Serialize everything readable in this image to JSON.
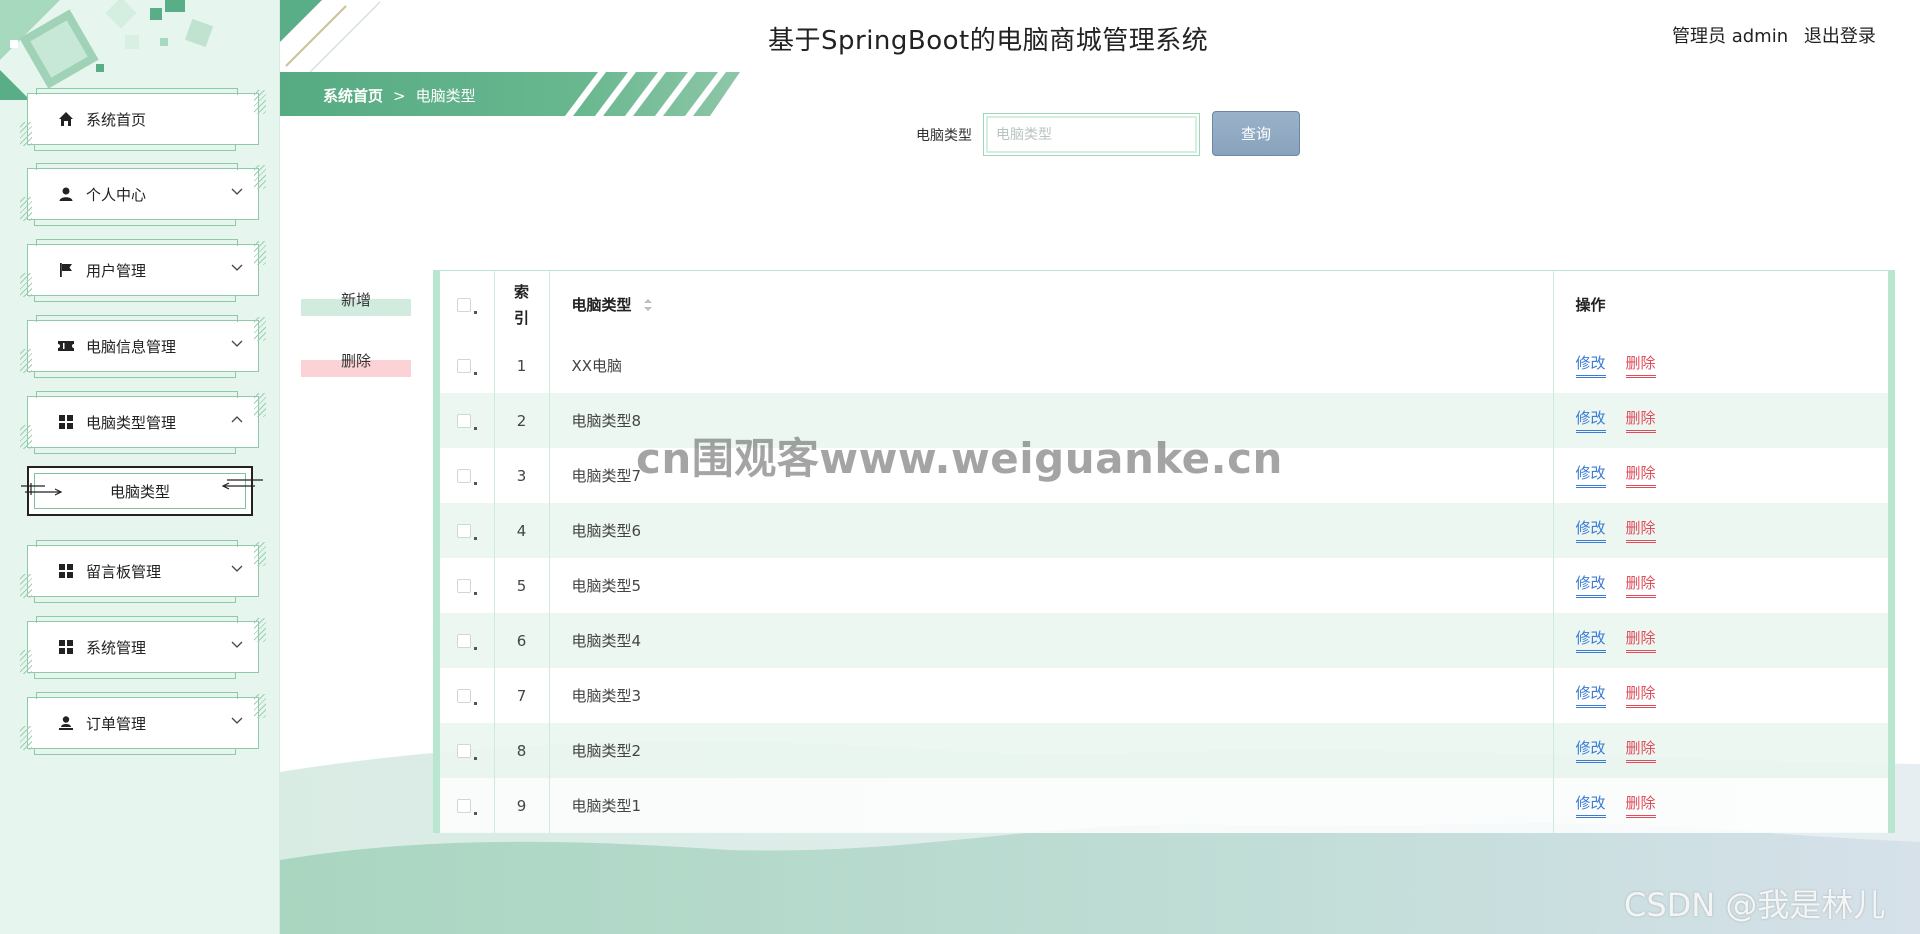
{
  "header": {
    "title": "基于SpringBoot的电脑商城管理系统",
    "user": "管理员 admin",
    "logout": "退出登录"
  },
  "breadcrumb": {
    "home": "系统首页",
    "separator": ">",
    "current": "电脑类型"
  },
  "sidebar": {
    "items": [
      {
        "label": "系统首页",
        "icon": "home-icon"
      },
      {
        "label": "个人中心",
        "icon": "user-icon"
      },
      {
        "label": "用户管理",
        "icon": "flag-icon"
      },
      {
        "label": "电脑信息管理",
        "icon": "ticket-icon"
      },
      {
        "label": "电脑类型管理",
        "icon": "grid-icon"
      },
      {
        "label": "留言板管理",
        "icon": "grid-icon"
      },
      {
        "label": "系统管理",
        "icon": "grid-icon"
      },
      {
        "label": "订单管理",
        "icon": "person-icon"
      }
    ],
    "subitem": "电脑类型"
  },
  "search": {
    "label": "电脑类型",
    "placeholder": "电脑类型",
    "button": "查询"
  },
  "actions": {
    "add": "新增",
    "delete": "删除"
  },
  "table": {
    "headers": {
      "index": "索引",
      "type": "电脑类型",
      "ops": "操作"
    },
    "edit_label": "修改",
    "delete_label": "删除",
    "rows": [
      {
        "index": "1",
        "type": "XX电脑"
      },
      {
        "index": "2",
        "type": "电脑类型8"
      },
      {
        "index": "3",
        "type": "电脑类型7"
      },
      {
        "index": "4",
        "type": "电脑类型6"
      },
      {
        "index": "5",
        "type": "电脑类型5"
      },
      {
        "index": "6",
        "type": "电脑类型4"
      },
      {
        "index": "7",
        "type": "电脑类型3"
      },
      {
        "index": "8",
        "type": "电脑类型2"
      },
      {
        "index": "9",
        "type": "电脑类型1"
      }
    ]
  },
  "watermarks": {
    "center": "cn围观客www.weiguanke.cn",
    "corner": "CSDN @我是林儿"
  },
  "colors": {
    "accent_green": "#5aae87",
    "sidebar_bg": "#e6f5ee",
    "edit_blue": "#3a7bd5",
    "delete_red": "#e14b5a",
    "search_button": "#8aa3bd"
  }
}
